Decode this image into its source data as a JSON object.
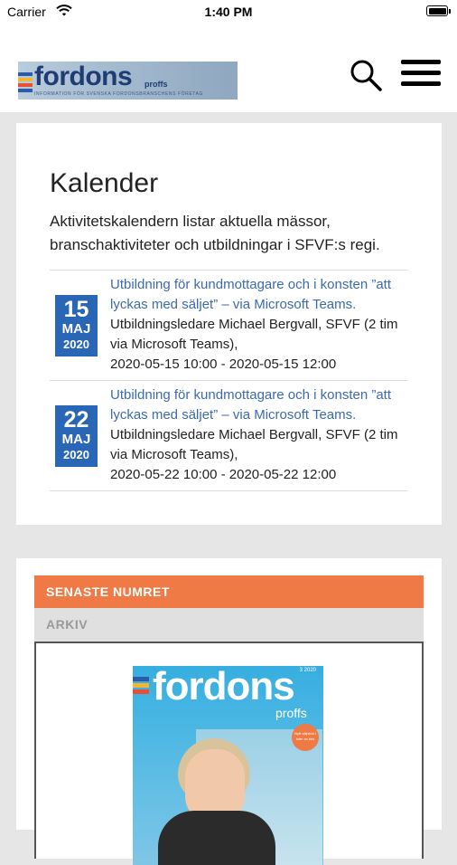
{
  "status_bar": {
    "carrier": "Carrier",
    "time": "1:40 PM"
  },
  "header": {
    "logo_word": "fordons",
    "logo_sub": "proffs",
    "logo_tagline": "INFORMATION FÖR SVENSKA FORDONSBRANSCHENS FÖRETAG",
    "logo_stripe_colors": [
      "#2a5caa",
      "#f2b632",
      "#e94f37",
      "#2a5caa"
    ]
  },
  "calendar": {
    "title": "Kalender",
    "description": "Aktivitetskalendern listar aktuella mässor, branschaktiviteter och utbildningar i SFVF:s regi.",
    "events": [
      {
        "day": "15",
        "month": "MAJ",
        "year": "2020",
        "title": "Utbildning för kundmottagare och i konsten ”att lyckas med säljet” – via Microsoft Teams.",
        "details": "Utbildningsledare Michael Bergvall, SFVF (2 tim via Microsoft Teams),",
        "time": "2020-05-15 10:00 - 2020-05-15 12:00"
      },
      {
        "day": "22",
        "month": "MAJ",
        "year": "2020",
        "title": "Utbildning för kundmottagare och i konsten ”att lyckas med säljet” – via Microsoft Teams.",
        "details": "Utbildningsledare Michael Bergvall, SFVF (2 tim via Microsoft Teams),",
        "time": "2020-05-22 10:00 - 2020-05-22 12:00"
      }
    ]
  },
  "magazine": {
    "active_tab": "SENASTE NUMRET",
    "archive_tab": "ARKIV",
    "cover": {
      "word": "fordons",
      "sub": "proffs",
      "issue": "3 2020",
      "badge": "Nytt säljstöd i tider av kris"
    }
  },
  "colors": {
    "accent_orange": "#ef7a45",
    "date_blue": "#2a66b6",
    "link_blue": "#3b6ab0"
  }
}
